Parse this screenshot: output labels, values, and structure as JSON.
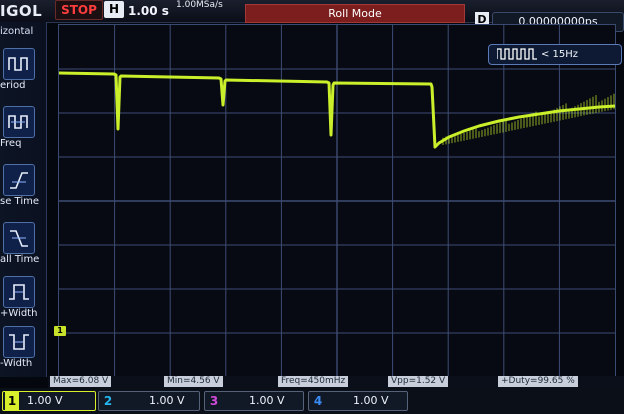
{
  "header": {
    "brand": "IGOL",
    "run_state": "STOP",
    "h_label": "H",
    "timebase": "1.00 s",
    "sample_rate": "1.00MSa/s",
    "mode": "Roll Mode",
    "delay_label": "D",
    "delay_value": "0.00000000ps"
  },
  "trigger": {
    "icon": "pulse-train-icon",
    "freq_label": "< 15Hz"
  },
  "sidebar": {
    "title": "izontal",
    "items": [
      {
        "label": "eriod",
        "icon": "period-icon"
      },
      {
        "label": "Freq",
        "icon": "freq-icon"
      },
      {
        "label": "se Time",
        "icon": "rise-time-icon"
      },
      {
        "label": "all Time",
        "icon": "fall-time-icon"
      },
      {
        "label": "+Width",
        "icon": "positive-width-icon"
      },
      {
        "label": "-Width",
        "icon": "negative-width-icon"
      }
    ]
  },
  "measurements": [
    {
      "text": "Max=6.08 V"
    },
    {
      "text": "Min=4.56 V"
    },
    {
      "text": "Freq=450mHz"
    },
    {
      "text": "Vpp=1.52 V"
    },
    {
      "text": "+Duty=99.65 %"
    }
  ],
  "channels": [
    {
      "num": "1",
      "scale": "1.00 V",
      "color": "#d7f02b",
      "active": true
    },
    {
      "num": "2",
      "scale": "1.00 V",
      "color": "#25b6f0",
      "active": false
    },
    {
      "num": "3",
      "scale": "1.00 V",
      "color": "#d04ad8",
      "active": false
    },
    {
      "num": "4",
      "scale": "1.00 V",
      "color": "#3a8cf5",
      "active": false
    }
  ],
  "colors": {
    "trace": "#c9f02a",
    "grid": "#3e4c74",
    "stop": "#ff3d3d",
    "roll_bg": "#7d1e1e"
  },
  "ch1_marker": "1"
}
